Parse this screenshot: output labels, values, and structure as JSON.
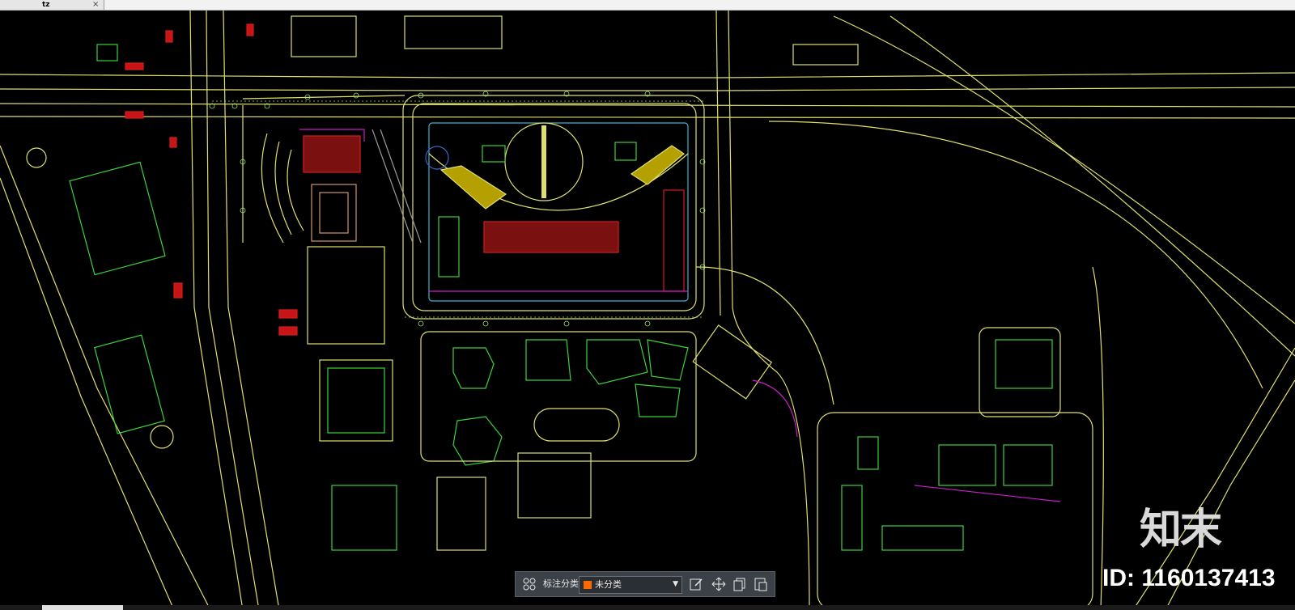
{
  "tab": {
    "title": "tz",
    "close": "×"
  },
  "toolbar": {
    "category_label": "标注分类",
    "selected_category": "未分类",
    "swatch_color": "#ff6a00"
  },
  "watermark": {
    "logo": "知末",
    "id_text": "ID: 1160137413"
  },
  "colors": {
    "background": "#000000",
    "yellow": "#e0e070",
    "green": "#3cd23c",
    "light_green": "#a0e66e",
    "red": "#d21e1e",
    "magenta": "#c81ec8",
    "blue": "#3c64c8",
    "cyan": "#3cb4d2"
  }
}
